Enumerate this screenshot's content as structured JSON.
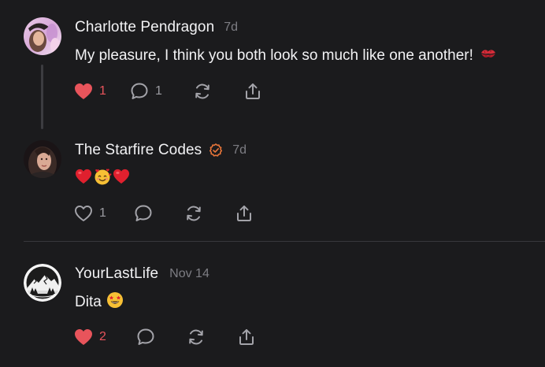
{
  "colors": {
    "background": "#1b1b1d",
    "like_red": "#e8545b",
    "muted": "#7d7d83",
    "verified_orange": "#e9763a"
  },
  "posts": [
    {
      "author": "Charlotte Pendragon",
      "time": "7d",
      "text": "My pleasure, I think you both look so much like one another!",
      "trailing_emoji": "kiss-mark-icon",
      "likes": "1",
      "liked": true,
      "replies": "1",
      "avatar": "charlotte-avatar"
    },
    {
      "author": "The Starfire Codes",
      "verified": true,
      "time": "7d",
      "emojis": [
        "red-heart-icon",
        "smiling-face-with-hearts-icon",
        "red-heart-icon"
      ],
      "likes": "1",
      "liked": false,
      "avatar": "starfire-avatar"
    },
    {
      "author": "YourLastLife",
      "time": "Nov 14",
      "text": "Dita",
      "trailing_emoji": "star-struck-icon",
      "likes": "2",
      "liked": true,
      "avatar": "mountain-logo-avatar"
    }
  ]
}
